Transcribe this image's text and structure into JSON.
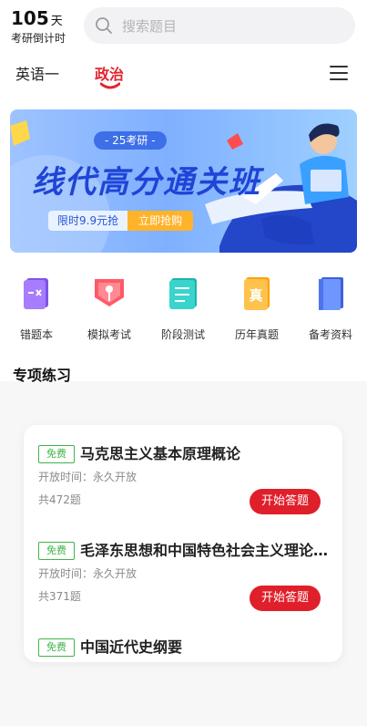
{
  "countdown": {
    "days": "105",
    "unit": "天",
    "label": "考研倒计时"
  },
  "search": {
    "placeholder": "搜索题目"
  },
  "subjects": [
    {
      "label": "英语一",
      "active": false
    },
    {
      "label": "政治",
      "active": true
    }
  ],
  "banner": {
    "tag": "- 25考研 -",
    "title": "线代高分通关班",
    "promo_left": "限时9.9元抢",
    "promo_right": "立即抢购"
  },
  "quick_links": [
    {
      "label": "错题本",
      "icon": "wrong-notebook-icon",
      "color": "#9b6cf2"
    },
    {
      "label": "模拟考试",
      "icon": "mock-exam-icon",
      "color": "#ff5a67"
    },
    {
      "label": "阶段测试",
      "icon": "stage-test-icon",
      "color": "#2cc7c0"
    },
    {
      "label": "历年真题",
      "icon": "past-papers-icon",
      "color": "#ffb21f"
    },
    {
      "label": "备考资料",
      "icon": "materials-icon",
      "color": "#4b7cf3"
    }
  ],
  "section": {
    "title": "专项练习"
  },
  "practice": [
    {
      "badge": "免费",
      "title": "马克思主义基本原理概论",
      "open": "开放时间：永久开放",
      "count": "共472题",
      "button": "开始答题"
    },
    {
      "badge": "免费",
      "title": "毛泽东思想和中国特色社会主义理论体系概论",
      "open": "开放时间：永久开放",
      "count": "共371题",
      "button": "开始答题"
    },
    {
      "badge": "免费",
      "title": "中国近代史纲要"
    }
  ],
  "colors": {
    "accent": "#e0262f",
    "free": "#40b34a",
    "banner_title": "#1f44d6"
  }
}
